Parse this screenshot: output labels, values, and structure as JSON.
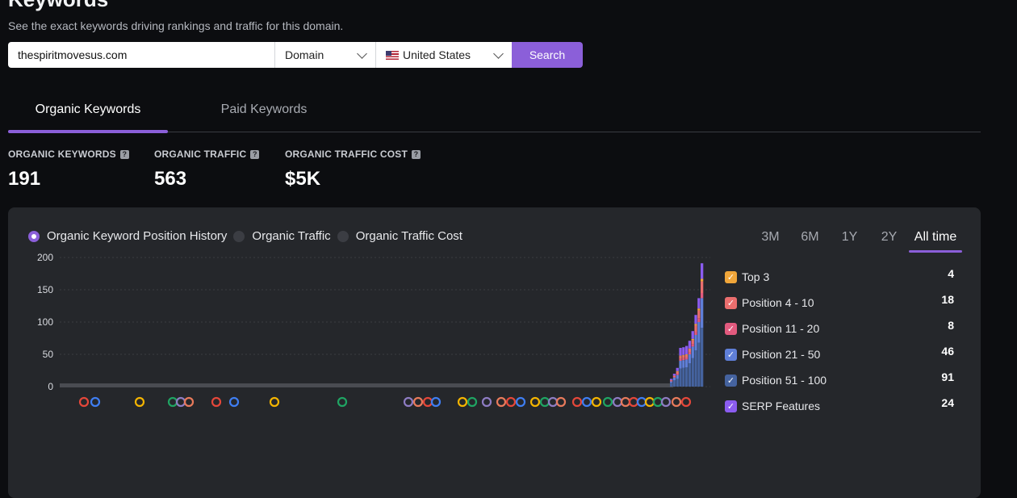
{
  "header": {
    "title": "Keywords",
    "subtitle": "See the exact keywords driving rankings and traffic for this domain."
  },
  "search": {
    "domain_value": "thespiritmovesus.com",
    "type_selected": "Domain",
    "country_selected": "United States",
    "button_label": "Search"
  },
  "tabs": [
    {
      "label": "Organic Keywords",
      "active": true
    },
    {
      "label": "Paid Keywords",
      "active": false
    }
  ],
  "metrics": [
    {
      "label": "ORGANIC KEYWORDS",
      "value": "191"
    },
    {
      "label": "ORGANIC TRAFFIC",
      "value": "563"
    },
    {
      "label": "ORGANIC TRAFFIC COST",
      "value": "$5K"
    }
  ],
  "chart_panel": {
    "views": [
      {
        "label": "Organic Keyword Position History",
        "selected": true
      },
      {
        "label": "Organic Traffic",
        "selected": false
      },
      {
        "label": "Organic Traffic Cost",
        "selected": false
      }
    ],
    "ranges": [
      "3M",
      "6M",
      "1Y",
      "2Y",
      "All time"
    ],
    "active_range": "All time",
    "legend": [
      {
        "label": "Top 3",
        "count": "4",
        "color": "#f0a63a"
      },
      {
        "label": "Position 4 - 10",
        "count": "18",
        "color": "#ea6e6e"
      },
      {
        "label": "Position 11 - 20",
        "count": "8",
        "color": "#e25a7e"
      },
      {
        "label": "Position 21 - 50",
        "count": "46",
        "color": "#5f7fd8"
      },
      {
        "label": "Position 51 - 100",
        "count": "91",
        "color": "#45639f"
      },
      {
        "label": "SERP Features",
        "count": "24",
        "color": "#8b5cf0"
      }
    ]
  },
  "chart_data": {
    "type": "bar",
    "stacked": true,
    "ylim": [
      0,
      200
    ],
    "yticks": [
      0,
      50,
      100,
      150,
      200
    ],
    "grid": true,
    "series_colors": {
      "top3": "#f0a63a",
      "pos4_10": "#ea6e6e",
      "pos11_20": "#e25a7e",
      "pos21_50": "#5f7fd8",
      "pos51_100": "#45639f",
      "serp": "#8b5cf0"
    },
    "bars": [
      {
        "top3": 0,
        "pos4_10": 1,
        "pos11_20": 1,
        "pos21_50": 2,
        "pos51_100": 6,
        "serp": 2
      },
      {
        "top3": 0,
        "pos4_10": 2,
        "pos11_20": 1,
        "pos21_50": 4,
        "pos51_100": 10,
        "serp": 3
      },
      {
        "top3": 1,
        "pos4_10": 3,
        "pos11_20": 2,
        "pos21_50": 6,
        "pos51_100": 12,
        "serp": 5
      },
      {
        "top3": 1,
        "pos4_10": 4,
        "pos11_20": 3,
        "pos21_50": 12,
        "pos51_100": 28,
        "serp": 12
      },
      {
        "top3": 1,
        "pos4_10": 4,
        "pos11_20": 3,
        "pos21_50": 12,
        "pos51_100": 29,
        "serp": 12
      },
      {
        "top3": 1,
        "pos4_10": 4,
        "pos11_20": 3,
        "pos21_50": 12,
        "pos51_100": 30,
        "serp": 13
      },
      {
        "top3": 1,
        "pos4_10": 5,
        "pos11_20": 3,
        "pos21_50": 14,
        "pos51_100": 36,
        "serp": 12
      },
      {
        "top3": 2,
        "pos4_10": 6,
        "pos11_20": 4,
        "pos21_50": 18,
        "pos51_100": 44,
        "serp": 12
      },
      {
        "top3": 2,
        "pos4_10": 10,
        "pos11_20": 5,
        "pos21_50": 24,
        "pos51_100": 56,
        "serp": 14
      },
      {
        "top3": 3,
        "pos4_10": 12,
        "pos11_20": 6,
        "pos21_50": 32,
        "pos51_100": 68,
        "serp": 16
      },
      {
        "top3": 4,
        "pos4_10": 18,
        "pos11_20": 8,
        "pos21_50": 46,
        "pos51_100": 91,
        "serp": 24
      }
    ]
  }
}
